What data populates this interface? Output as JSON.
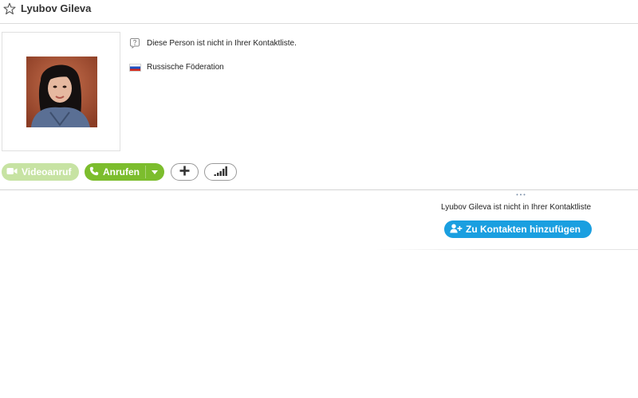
{
  "header": {
    "contact_name": "Lyubov Gileva",
    "favorite_icon": "star-outline-icon"
  },
  "profile": {
    "avatar_icon": "profile-photo",
    "contact_status": "Diese Person ist nicht in Ihrer Kontaktliste.",
    "country": "Russische Föderation",
    "country_flag": "russia-flag-icon"
  },
  "actions": {
    "video_call_label": "Videoanruf",
    "video_call_enabled": false,
    "call_label": "Anrufen",
    "add_icon": "plus-icon",
    "quality_icon": "signal-bars-icon"
  },
  "notice": {
    "text": "Lyubov Gileva ist nicht in Ihrer Kontaktliste",
    "add_contact_label": "Zu Kontakten hinzufügen",
    "add_contact_icon": "add-person-icon"
  },
  "colors": {
    "call_green": "#7cbd2d",
    "video_disabled_green": "#c7e3a3",
    "add_contact_blue": "#1a9fe0"
  }
}
